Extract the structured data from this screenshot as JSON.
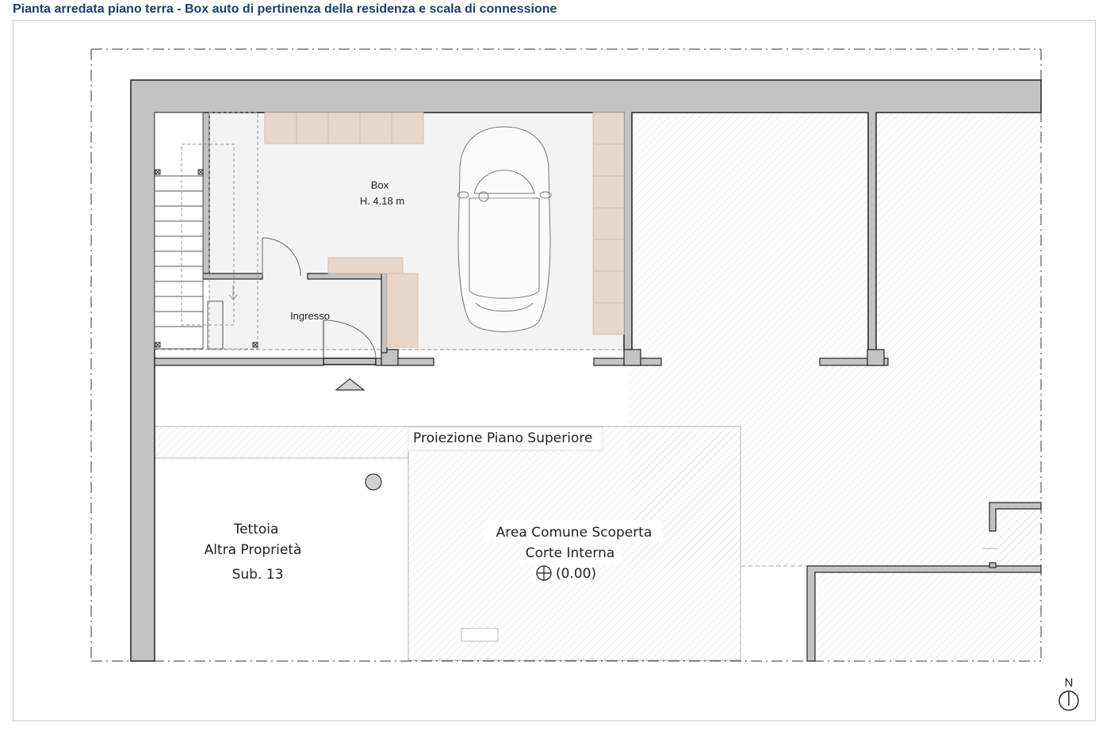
{
  "title": "Pianta arredata piano terra - Box auto di pertinenza della residenza e scala di connessione",
  "rooms": {
    "box_name": "Box",
    "box_height": "H. 4.18 m",
    "ingresso": "Ingresso"
  },
  "projection_label": "Proiezione Piano Superiore",
  "tettoia": {
    "line1": "Tettoia",
    "line2": "Altra Proprietà",
    "line3": "Sub. 13"
  },
  "courtyard": {
    "line1": "Area Comune Scoperta",
    "line2": "Corte Interna",
    "elevation": "(0.00)"
  },
  "north_label": "N",
  "colors": {
    "title": "#1f3d6e",
    "wall": "#c3c3c3",
    "furniture": "#e8d6c8",
    "room_fill": "#f3f3f3"
  }
}
